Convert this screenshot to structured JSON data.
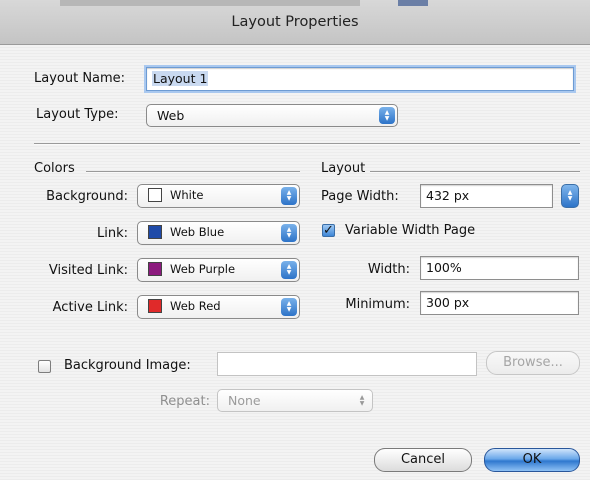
{
  "window": {
    "title": "Layout Properties"
  },
  "layout_name": {
    "label": "Layout Name:",
    "value": "Layout 1"
  },
  "layout_type": {
    "label": "Layout Type:",
    "value": "Web"
  },
  "colors": {
    "section_label": "Colors",
    "background": {
      "label": "Background:",
      "value": "White",
      "color": "#ffffff"
    },
    "link": {
      "label": "Link:",
      "value": "Web Blue",
      "color": "#1f4aa8"
    },
    "visited_link": {
      "label": "Visited Link:",
      "value": "Web Purple",
      "color": "#8c1a7e"
    },
    "active_link": {
      "label": "Active Link:",
      "value": "Web Red",
      "color": "#e02a2a"
    }
  },
  "layout": {
    "section_label": "Layout",
    "page_width": {
      "label": "Page Width:",
      "value": "432 px"
    },
    "variable_width": {
      "label": "Variable Width Page",
      "checked": true
    },
    "width": {
      "label": "Width:",
      "value": "100%"
    },
    "minimum": {
      "label": "Minimum:",
      "value": "300 px"
    }
  },
  "background_image": {
    "label": "Background Image:",
    "checked": false,
    "value": "",
    "browse_label": "Browse..."
  },
  "repeat": {
    "label": "Repeat:",
    "value": "None"
  },
  "buttons": {
    "cancel": "Cancel",
    "ok": "OK"
  },
  "icons": {
    "popup_arrows": "up-down-arrows-icon",
    "checkmark": "checkmark-icon"
  }
}
